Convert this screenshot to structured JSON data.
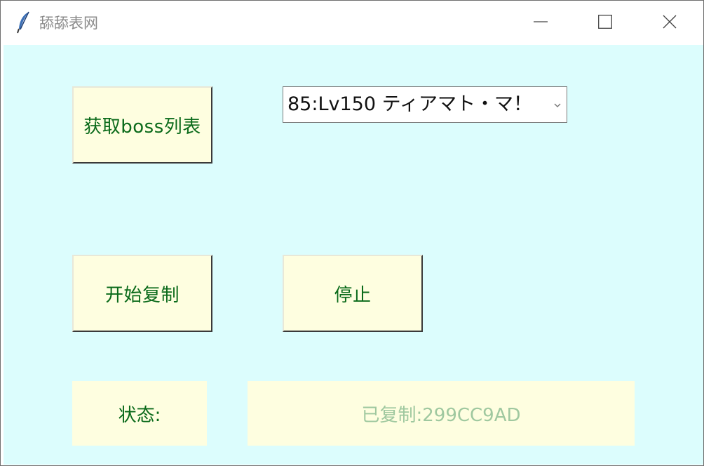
{
  "window": {
    "title": "舔舔表网",
    "app_icon": "feather-icon",
    "controls": {
      "minimize_icon": "minimize-icon",
      "maximize_icon": "maximize-icon",
      "close_icon": "close-icon"
    }
  },
  "buttons": {
    "get_boss_list": "获取boss列表",
    "start_copy": "开始复制",
    "stop": "停止"
  },
  "boss_select": {
    "selected": "85:Lv150 ティアマト・マ！"
  },
  "status": {
    "label": "状态:",
    "value": "已复制:299CC9AD"
  },
  "colors": {
    "client_background": "#dcfdfd",
    "button_background": "#fefee0",
    "button_text": "#0a6a1a",
    "status_value_text": "#9fc89f"
  }
}
